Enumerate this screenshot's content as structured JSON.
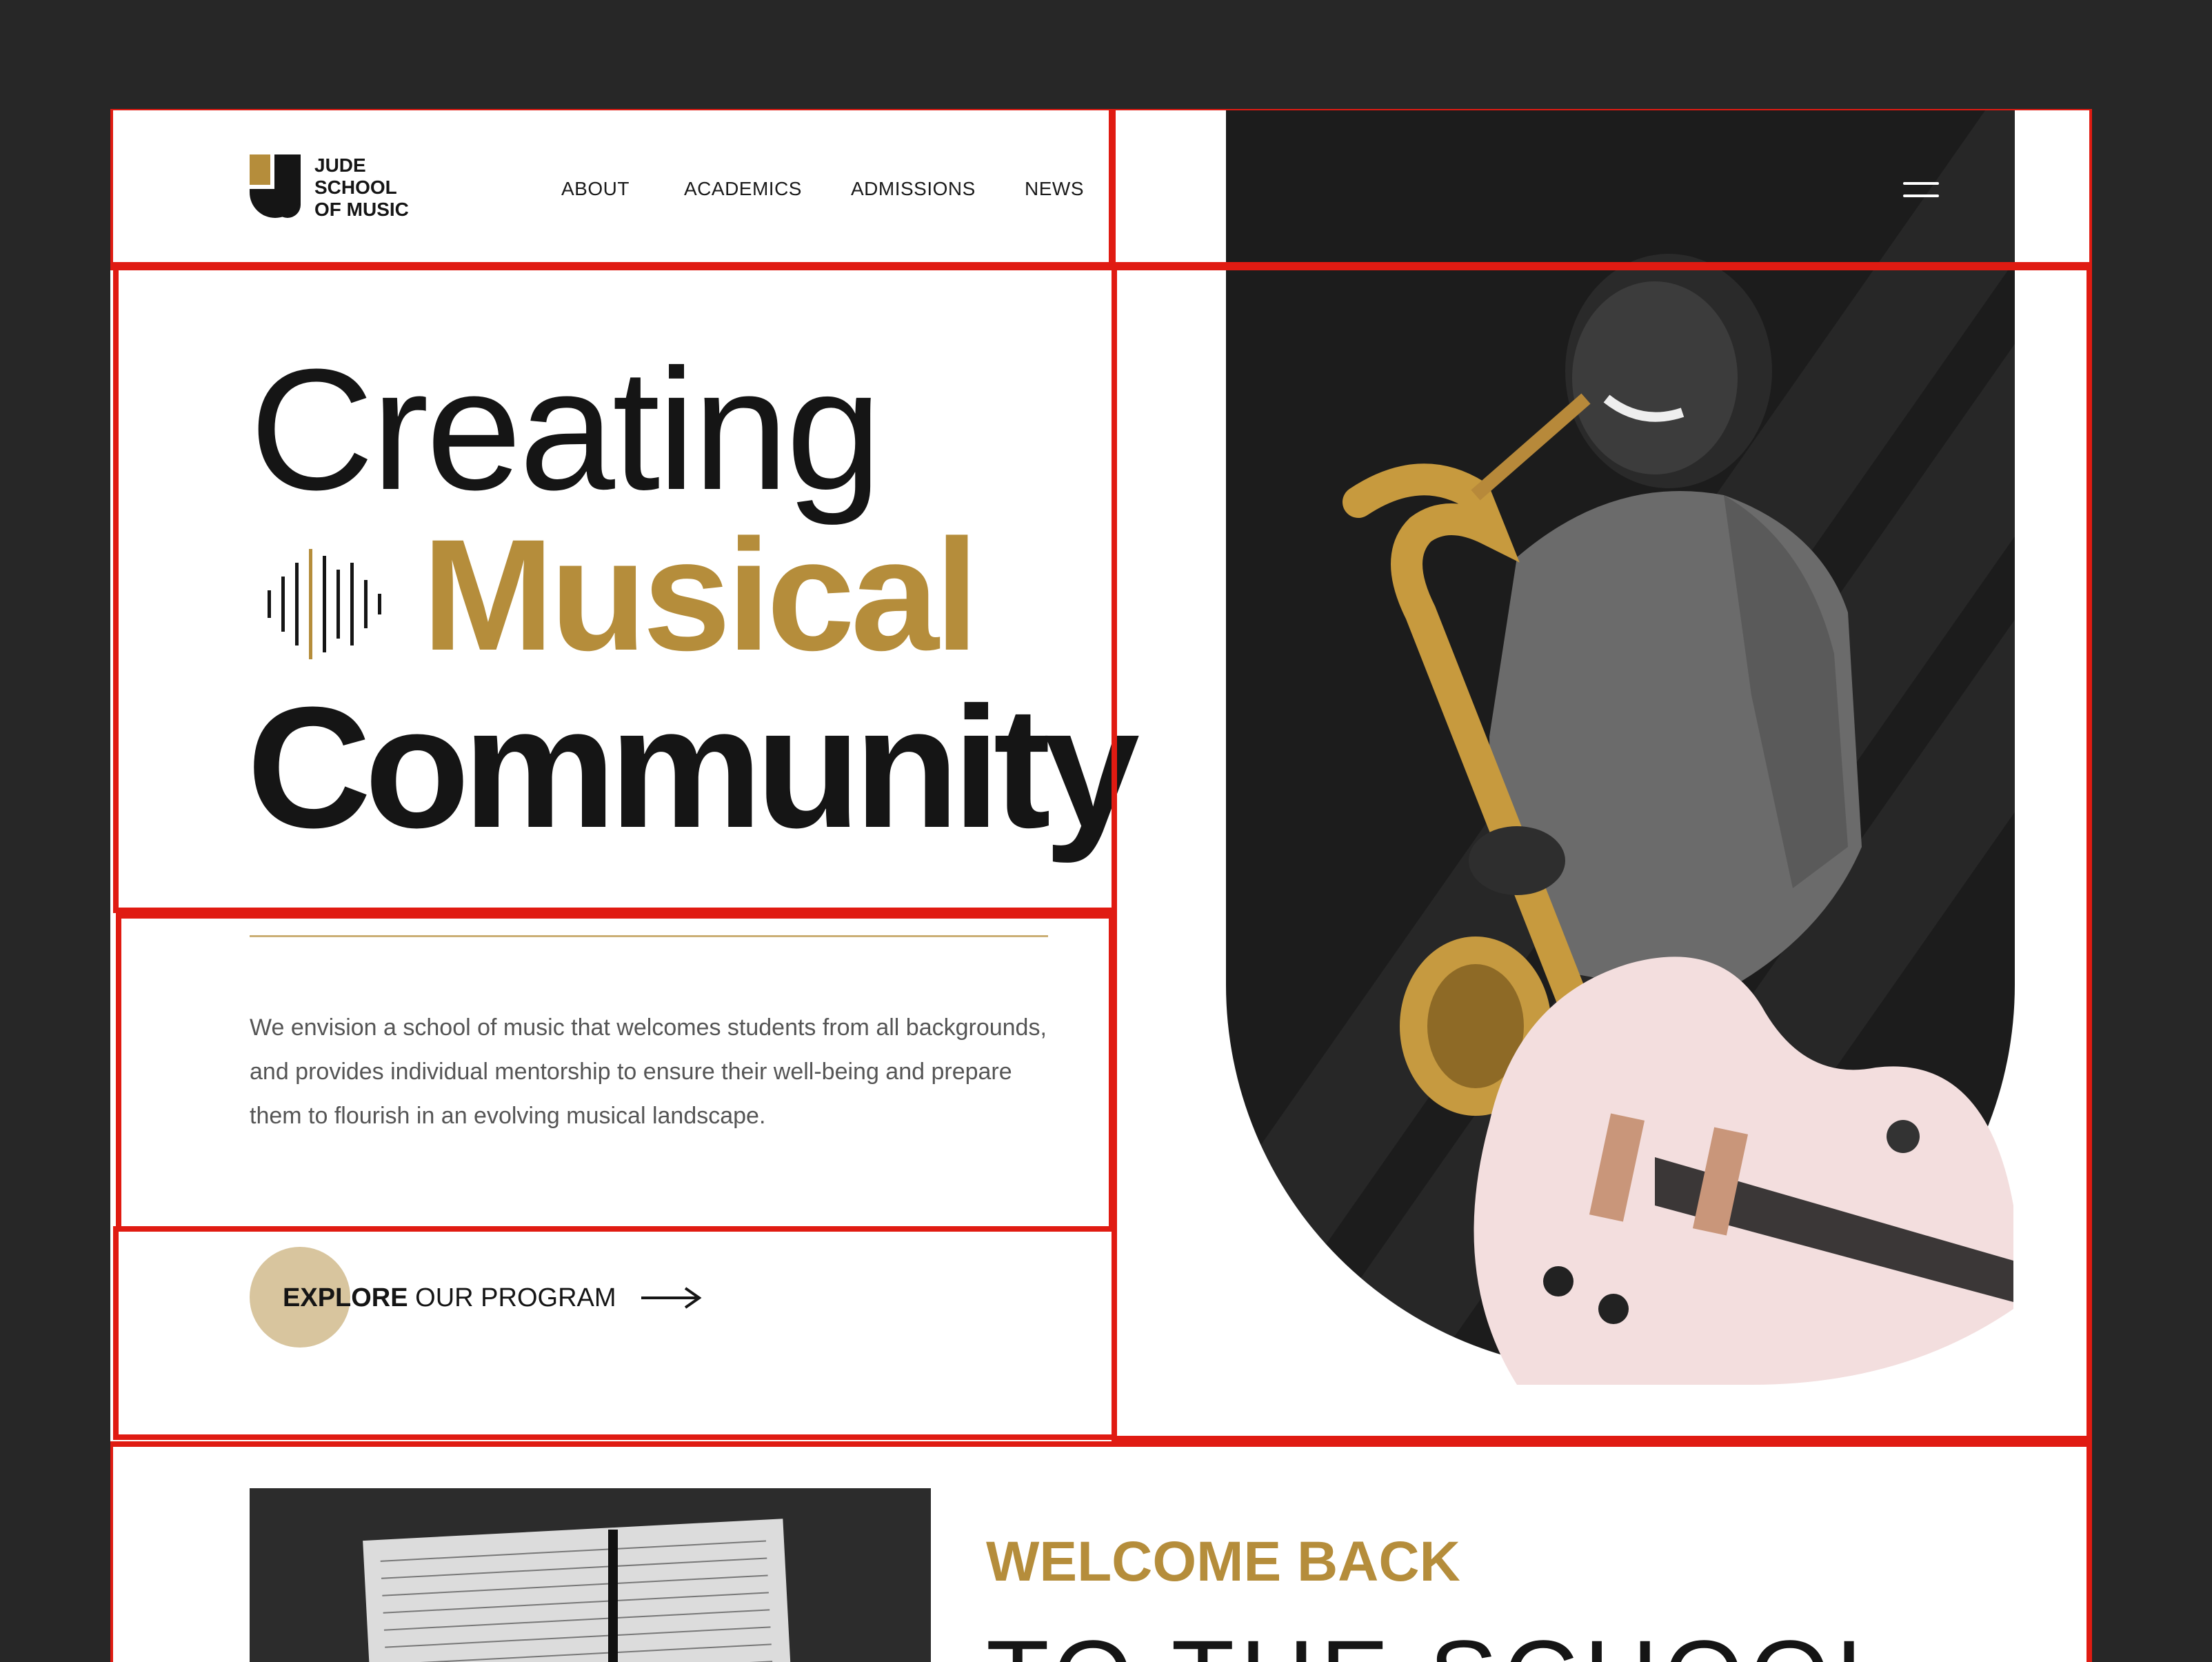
{
  "brand": {
    "line1": "JUDE",
    "line2": "SCHOOL",
    "line3": "OF MUSIC"
  },
  "nav": {
    "items": [
      {
        "label": "ABOUT"
      },
      {
        "label": "ACADEMICS"
      },
      {
        "label": "ADMISSIONS"
      },
      {
        "label": "NEWS"
      }
    ]
  },
  "hero": {
    "line1": "Creating",
    "line2": "Musical",
    "line3": "Community",
    "description": "We envision a school of music that welcomes students from all backgrounds, and provides individual mentorship to ensure their well-being and prepare them to flourish in an evolving musical landscape.",
    "cta_bold": "EXPLORE",
    "cta_rest": " OUR PROGRAM"
  },
  "welcome": {
    "heading": "WELCOME BACK",
    "subheading": "TO THE SCHOOL"
  },
  "colors": {
    "accent_gold": "#b58d3b",
    "text_dark": "#151515",
    "annotation_red": "#e01b12"
  },
  "icons": [
    "logo-j-icon",
    "hamburger-menu-icon",
    "sound-wave-icon",
    "arrow-right-icon"
  ]
}
